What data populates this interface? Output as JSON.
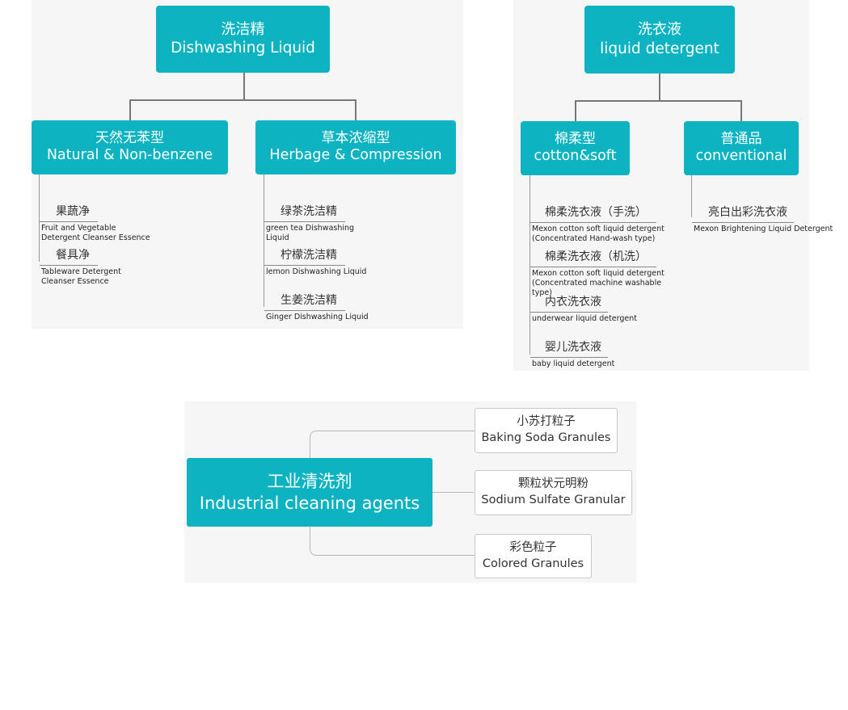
{
  "dishwashing": {
    "root": {
      "zh": "洗洁精",
      "en": "Dishwashing Liquid"
    },
    "branches": [
      {
        "zh": "天然无苯型",
        "en": "Natural & Non-benzene",
        "items": [
          {
            "zh": "果蔬净",
            "en": "Fruit and Vegetable Detergent Cleanser Essence"
          },
          {
            "zh": "餐具净",
            "en": "Tableware Detergent Cleanser Essence"
          }
        ]
      },
      {
        "zh": "草本浓缩型",
        "en": "Herbage & Compression",
        "items": [
          {
            "zh": "绿茶洗洁精",
            "en": "green tea Dishwashing Liquid"
          },
          {
            "zh": "柠檬洗洁精",
            "en": "lemon Dishwashing Liquid"
          },
          {
            "zh": "生姜洗洁精",
            "en": "Ginger Dishwashing Liquid"
          }
        ]
      }
    ]
  },
  "laundry": {
    "root": {
      "zh": "洗衣液",
      "en": "liquid detergent"
    },
    "branches": [
      {
        "zh": "棉柔型",
        "en": "cotton&soft",
        "items": [
          {
            "zh": "棉柔洗衣液（手洗）",
            "en": "Mexon cotton soft liquid detergent (Concentrated Hand-wash type)"
          },
          {
            "zh": "棉柔洗衣液（机洗）",
            "en": "Mexon cotton soft liquid detergent (Concentrated machine washable type)"
          },
          {
            "zh": "内衣洗衣液",
            "en": "underwear liquid detergent"
          },
          {
            "zh": "婴儿洗衣液",
            "en": "baby liquid detergent"
          }
        ]
      },
      {
        "zh": "普通品",
        "en": "conventional",
        "items": [
          {
            "zh": "亮白出彩洗衣液",
            "en": "Mexon Brightening Liquid Detergent"
          }
        ]
      }
    ]
  },
  "industrial": {
    "root": {
      "zh": "工业清洗剂",
      "en": "Industrial cleaning agents"
    },
    "items": [
      {
        "zh": "小苏打粒子",
        "en": "Baking Soda Granules"
      },
      {
        "zh": "颗粒状元明粉",
        "en": "Sodium Sulfate Granular"
      },
      {
        "zh": "彩色粒子",
        "en": "Colored Granules"
      }
    ]
  },
  "colors": {
    "accent": "#0db3c0",
    "line": "#777777",
    "panel": "#f6f6f6"
  }
}
